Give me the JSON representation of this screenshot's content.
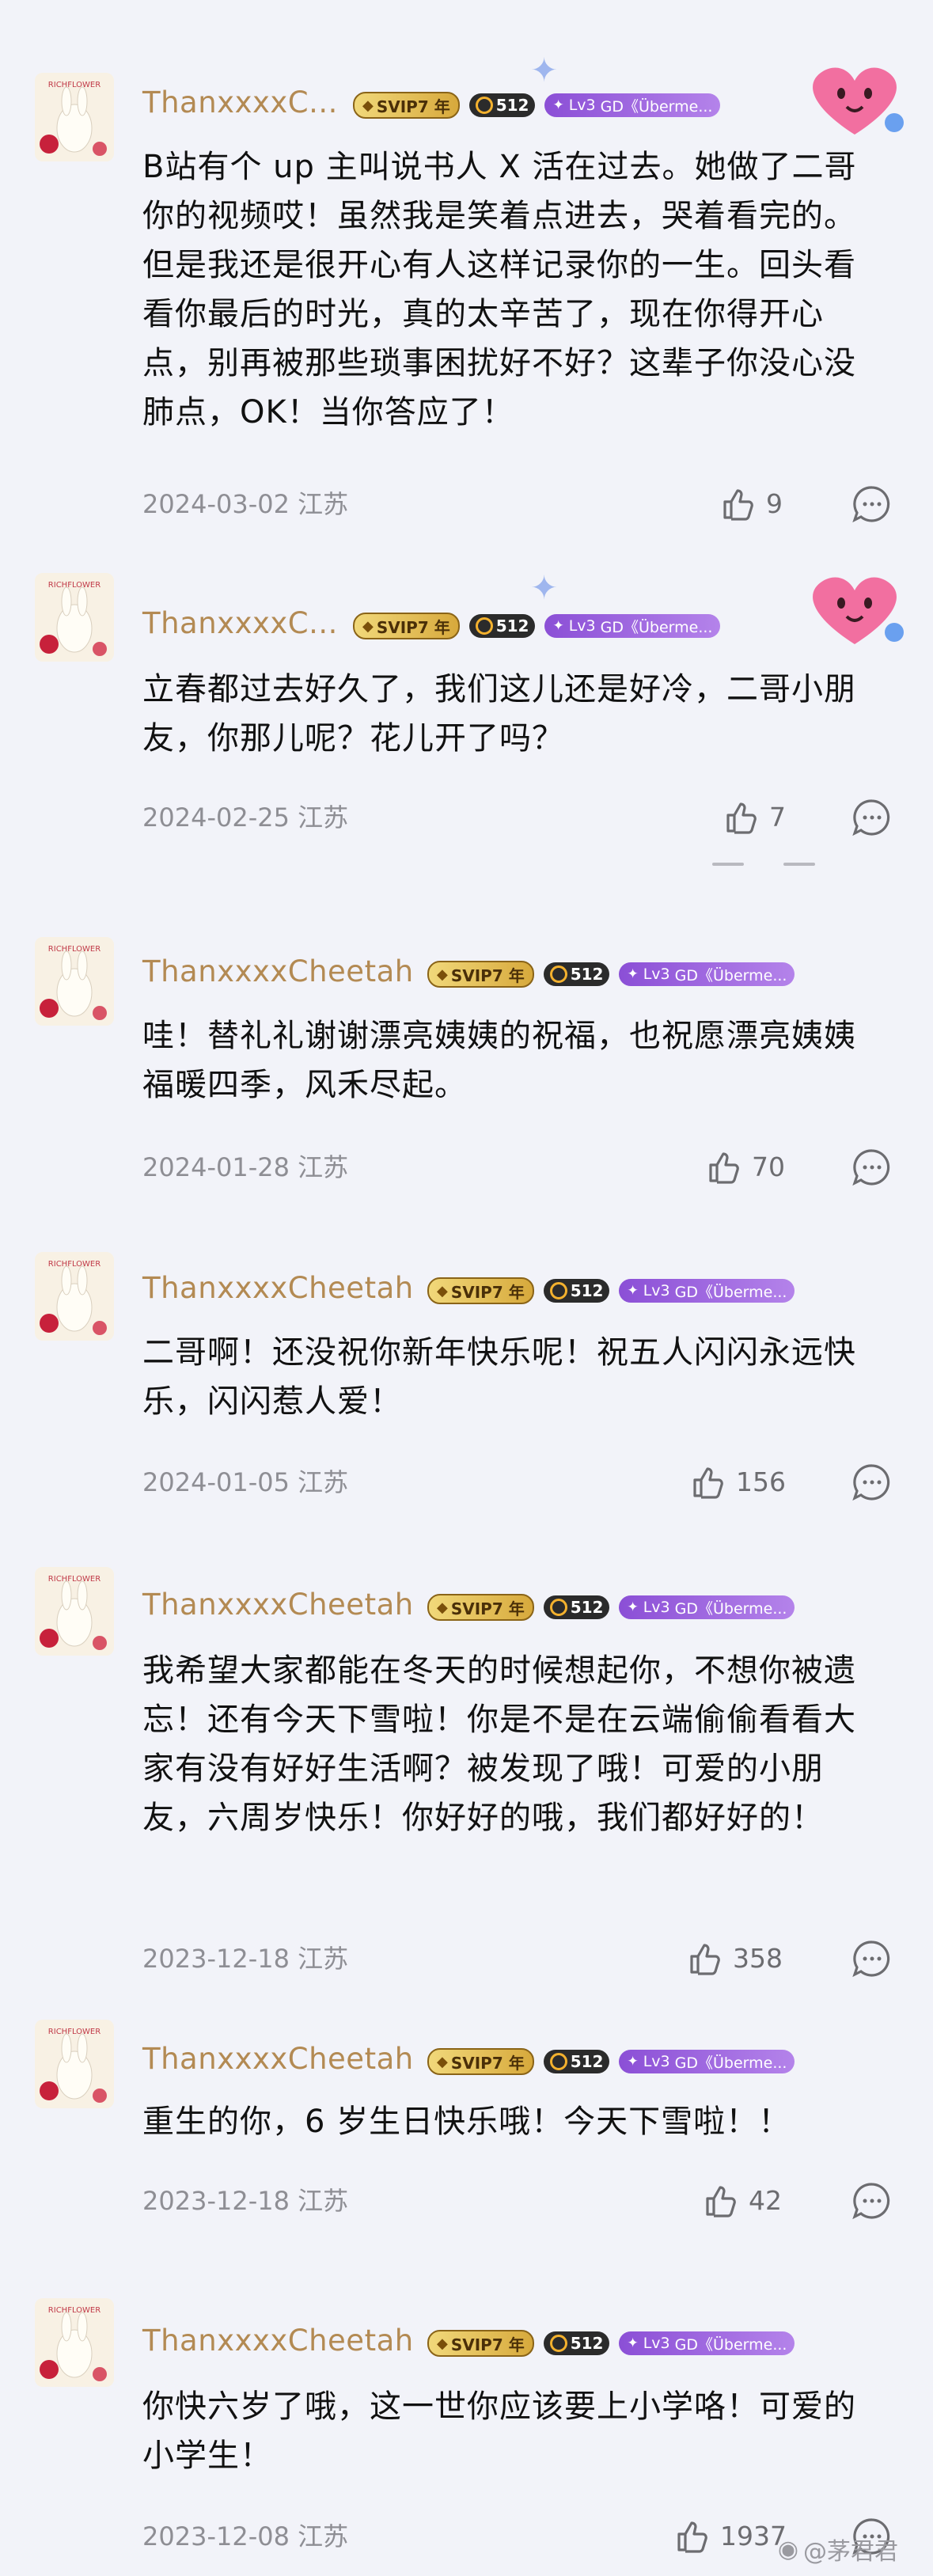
{
  "badges": {
    "svip": "SVIP7 年",
    "lv_num": "Lv3",
    "lv_text": "GD《Überme..."
  },
  "comments": [
    {
      "username": "ThanxxxxC...",
      "text": "B站有个 up 主叫说书人 X 活在过去。她做了二哥你的视频哎！虽然我是笑着点进去，哭着看完的。但是我还是很开心有人这样记录你的一生。回头看看你最后的时光，真的太辛苦了，现在你得开心点，别再被那些琐事困扰好不好？这辈子你没心没肺点，OK！当你答应了！",
      "date": "2024-03-02",
      "location": "江苏",
      "likes": "9"
    },
    {
      "username": "ThanxxxxC...",
      "text": "立春都过去好久了，我们这儿还是好冷，二哥小朋友，你那儿呢？花儿开了吗？",
      "date": "2024-02-25",
      "location": "江苏",
      "likes": "7"
    },
    {
      "username": "ThanxxxxCheetah",
      "text": "哇！替礼礼谢谢漂亮姨姨的祝福，也祝愿漂亮姨姨福暖四季，风禾尽起。",
      "date": "2024-01-28",
      "location": "江苏",
      "likes": "70"
    },
    {
      "username": "ThanxxxxCheetah",
      "text": "二哥啊！还没祝你新年快乐呢！祝五人闪闪永远快乐，闪闪惹人爱！",
      "date": "2024-01-05",
      "location": "江苏",
      "likes": "156"
    },
    {
      "username": "ThanxxxxCheetah",
      "text": "我希望大家都能在冬天的时候想起你，不想你被遗忘！还有今天下雪啦！你是不是在云端偷偷看看大家有没有好好生活啊？被发现了哦！可爱的小朋友，六周岁快乐！你好好的哦，我们都好好的！",
      "date": "2023-12-18",
      "location": "江苏",
      "likes": "358"
    },
    {
      "username": "ThanxxxxCheetah",
      "text": "重生的你，6 岁生日快乐哦！今天下雪啦！！",
      "date": "2023-12-18",
      "location": "江苏",
      "likes": "42"
    },
    {
      "username": "ThanxxxxCheetah",
      "text": "你快六岁了哦，这一世你应该要上小学咯！可爱的小学生！",
      "date": "2023-12-08",
      "location": "江苏",
      "likes": "1937"
    }
  ],
  "watermark": "@茅君君",
  "colors": {
    "username": "#b38a53",
    "meta": "#8e8e94",
    "background": "#f2f3f9"
  }
}
